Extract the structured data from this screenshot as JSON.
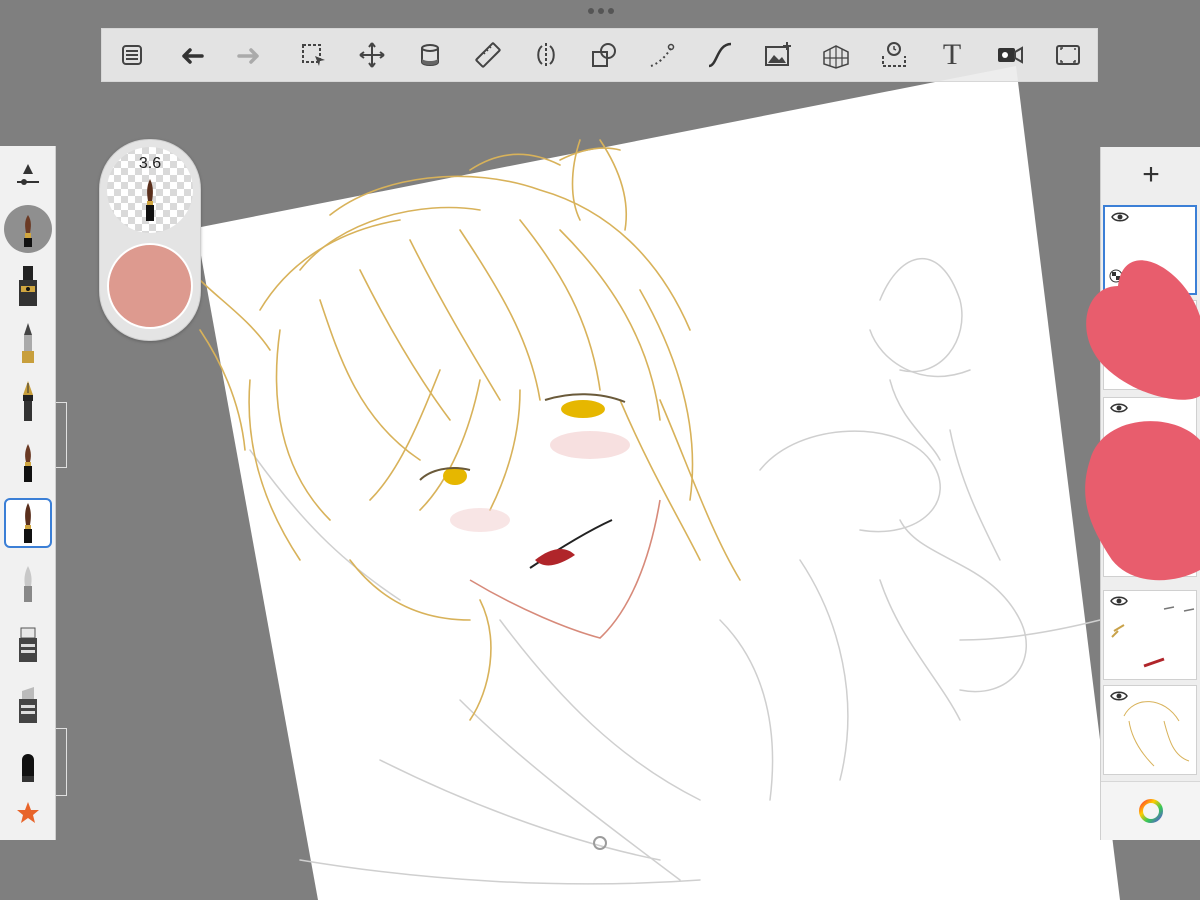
{
  "colors": {
    "current_color": "#dd9a8f",
    "accent": "#3b7fd6",
    "heart": "#e85d6d",
    "sketch_gold": "#d8b25a",
    "lip_red": "#b0252a"
  },
  "toolbar": {
    "items": [
      {
        "name": "menu-icon"
      },
      {
        "name": "undo-icon"
      },
      {
        "name": "redo-icon"
      },
      {
        "name": "selection-icon"
      },
      {
        "name": "transform-icon"
      },
      {
        "name": "fill-icon"
      },
      {
        "name": "ruler-icon"
      },
      {
        "name": "symmetry-icon"
      },
      {
        "name": "shapes-icon"
      },
      {
        "name": "stroke-icon"
      },
      {
        "name": "curve-icon"
      },
      {
        "name": "image-import-icon"
      },
      {
        "name": "perspective-icon"
      },
      {
        "name": "time-lapse-icon"
      },
      {
        "name": "text-icon",
        "label": "T"
      },
      {
        "name": "record-icon"
      },
      {
        "name": "fullscreen-icon"
      }
    ]
  },
  "brush_puck": {
    "size_value": "3.6"
  },
  "brush_palette": {
    "brushes": [
      "brush-settings-icon",
      "paintbrush-icon",
      "airbrush-icon",
      "pencil-icon",
      "ink-pen-icon",
      "marker-icon",
      "paintbrush-selected-icon",
      "soft-eraser-icon",
      "smudge-icon",
      "blender-icon",
      "eraser-icon",
      "favorite-star-icon"
    ]
  },
  "layers_panel": {
    "add_label": "+",
    "color_wheel": "color-wheel-icon",
    "layer_count": 5
  }
}
